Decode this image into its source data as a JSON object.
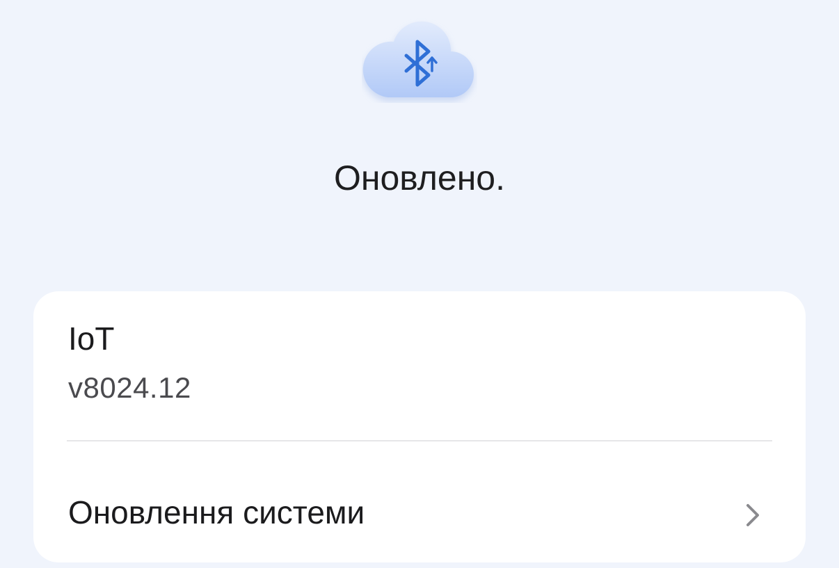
{
  "header": {
    "icon": "bluetooth-update-cloud-icon",
    "status_text": "Оновлено."
  },
  "card": {
    "module_name": "IoT",
    "module_version": "v8024.12",
    "system_update_label": "Оновлення системи",
    "chevron_icon": "chevron-right-icon"
  },
  "colors": {
    "background": "#f0f4fc",
    "card": "#ffffff",
    "cloud_light": "#dce6fb",
    "cloud_dark": "#b3cbf8",
    "bluetooth_icon": "#2f6fd6",
    "chevron": "#8a8a8e"
  }
}
